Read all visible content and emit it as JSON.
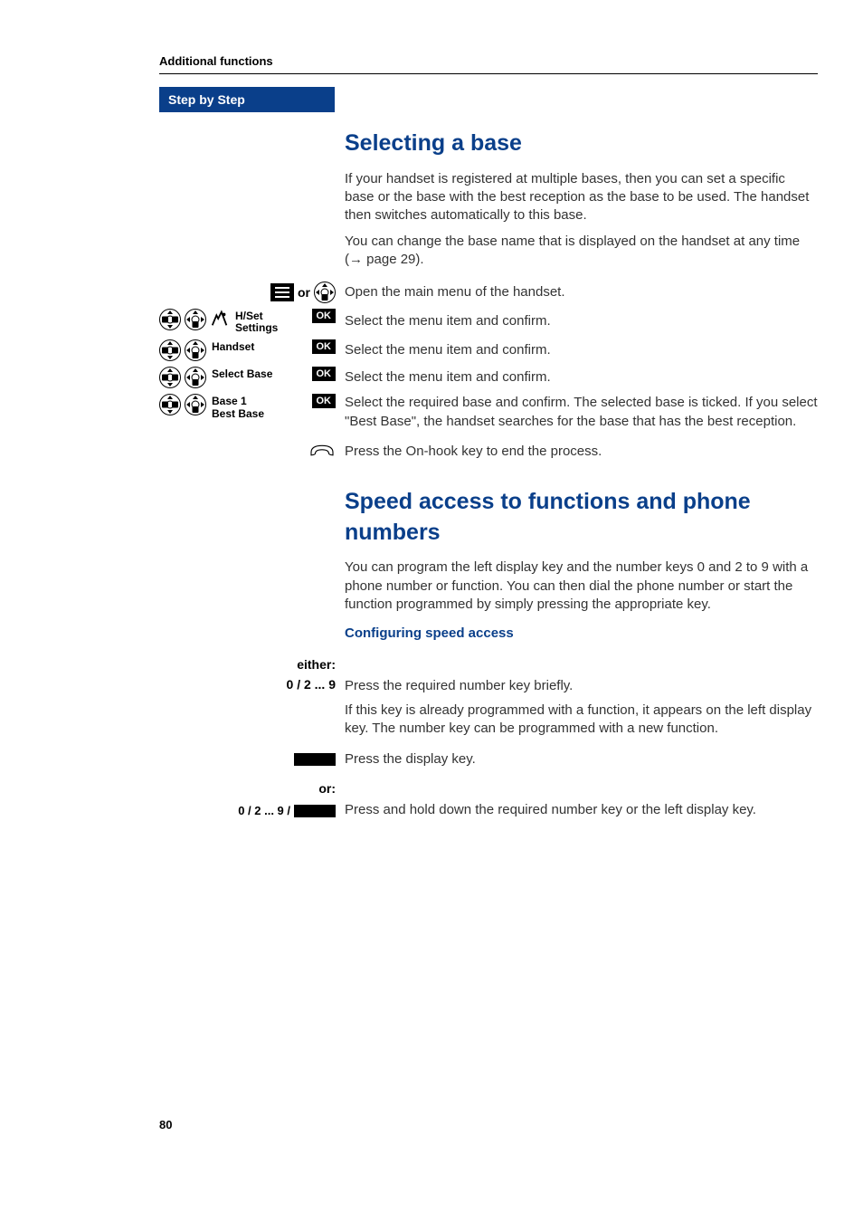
{
  "header": {
    "section": "Additional functions",
    "step_by_step": "Step by Step"
  },
  "section1": {
    "title": "Selecting a base",
    "para1": "If your handset is registered at multiple bases, then you can set a specific base or the base with the best reception as the base to be used. The handset then switches automatically to this base.",
    "para2_a": "You can change the base name that is displayed on the handset at any time (",
    "para2_link": "→ page 29",
    "para2_b": ").",
    "or_label": "or",
    "open_main_menu": "Open the main menu of the handset.",
    "hset_label": "H/Set Settings",
    "ok_label": "OK",
    "select_confirm": "Select the menu item and confirm.",
    "handset_label": "Handset",
    "selectbase_label": "Select Base",
    "base_options": "Base 1\nBest Base",
    "select_required": "Select the required base and confirm. The selected base is ticked. If you select \"Best Base\", the handset searches for the base that has the best reception.",
    "onhook": "Press the On-hook key to end the process."
  },
  "section2": {
    "title": "Speed access to functions and phone numbers",
    "intro": "You can program the left display key and the number keys 0 and 2 to 9 with a phone number or function. You can then dial the phone number or start the function programmed by simply pressing the appropriate key.",
    "config_heading": "Configuring speed access",
    "either_label": "either:",
    "keys1": "0 / 2 ... 9",
    "press_briefly": "Press the required number key briefly.",
    "already_prog": "If this key is already programmed with a function, it appears on the left display key. The number key can be programmed with a new function.",
    "press_display": "Press the display key.",
    "or_label": "or:",
    "keys2": "0 / 2 ... 9 /",
    "press_hold": "Press and hold down the required number key or the left display key."
  },
  "page_number": "80"
}
